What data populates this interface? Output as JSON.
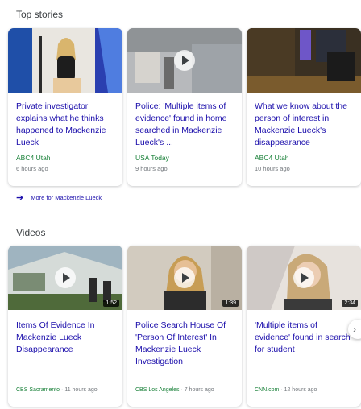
{
  "top_stories": {
    "title": "Top stories",
    "cards": [
      {
        "headline": "Private investigator explains what he thinks happened to Mackenzie Lueck",
        "source": "ABC4 Utah",
        "age": "6 hours ago"
      },
      {
        "headline": "Police: 'Multiple items of evidence' found in home searched in Mackenzie Lueck's ...",
        "source": "USA Today",
        "age": "9 hours ago"
      },
      {
        "headline": "What we know about the person of interest in Mackenzie Lueck's disappearance",
        "source": "ABC4 Utah",
        "age": "10 hours ago"
      }
    ],
    "more_label": "More for Mackenzie Lueck"
  },
  "videos": {
    "title": "Videos",
    "cards": [
      {
        "headline": "Items Of Evidence In Mackenzie Lueck Disappearance",
        "duration": "1:52",
        "source": "CBS Sacramento",
        "age": "· 11 hours ago"
      },
      {
        "headline": "Police Search House Of 'Person Of Interest' In Mackenzie Lueck Investigation",
        "duration": "1:39",
        "source": "CBS Los Angeles",
        "age": "· 7 hours ago"
      },
      {
        "headline": "'Multiple items of evidence' found in search for student",
        "duration": "2:34",
        "source": "CNN.com",
        "age": "· 12 hours ago"
      }
    ]
  },
  "icons": {
    "more_arrow": "arrow-right-icon",
    "play": "play-icon",
    "scroll": "chevron-right-icon"
  },
  "colors": {
    "link": "#1a0dab",
    "source": "#188038",
    "meta": "#70757a"
  }
}
